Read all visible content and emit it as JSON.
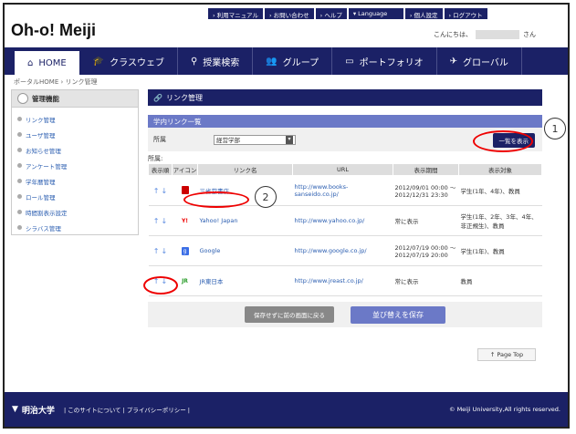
{
  "header": {
    "logo": "Oh-o! Meiji",
    "utility": [
      "› 利用マニュアル",
      "› お問い合わせ",
      "› ヘルプ",
      "▾ Language",
      "› 個人設定",
      "› ログアウト"
    ],
    "greeting_prefix": "こんにちは、",
    "greeting_suffix": "さん"
  },
  "nav": [
    "HOME",
    "クラスウェブ",
    "授業検索",
    "グループ",
    "ポートフォリオ",
    "グローバル"
  ],
  "breadcrumb": "ポータルHOME › リンク管理",
  "sidebar": {
    "title": "管理機能",
    "items": [
      "リンク管理",
      "ユーザ管理",
      "お知らせ管理",
      "アンケート管理",
      "学年暦管理",
      "ロール管理",
      "時間割表示設定",
      "シラバス管理"
    ]
  },
  "main": {
    "title": "リンク管理",
    "section": "学内リンク一覧",
    "filter_label": "所属",
    "filter_value": "経営学部",
    "show_button": "一覧を表示",
    "shozoku": "所属:"
  },
  "table": {
    "headers": [
      "表示順",
      "アイコン",
      "リンク名",
      "URL",
      "表示期間",
      "表示対象"
    ],
    "rows": [
      {
        "name": "三省堂書店",
        "url": "http://www.books-sanseido.co.jp/",
        "period": "2012/09/01 00:00 ～ 2012/12/31 23:30",
        "target": "学生(1年、4年)、教員"
      },
      {
        "name": "Yahoo! Japan",
        "url": "http://www.yahoo.co.jp/",
        "period": "常に表示",
        "target": "学生(1年、2年、3年、4年、非正規生)、教員"
      },
      {
        "name": "Google",
        "url": "http://www.google.co.jp/",
        "period": "2012/07/19 00:00 ～ 2012/07/19 20:00",
        "target": "学生(1年)、教員"
      },
      {
        "name": "JR東日本",
        "url": "http://www.jreast.co.jp/",
        "period": "常に表示",
        "target": "教員"
      }
    ]
  },
  "buttons": {
    "back": "保存せずに前の画面に戻る",
    "save": "並び替えを保存"
  },
  "callouts": [
    "1",
    "2"
  ],
  "pagetop": "↑ Page Top",
  "footer": {
    "logo": "明治大学",
    "links": "| このサイトについて | プライバシーポリシー |",
    "copyright": "© Meiji University,All rights reserved."
  }
}
